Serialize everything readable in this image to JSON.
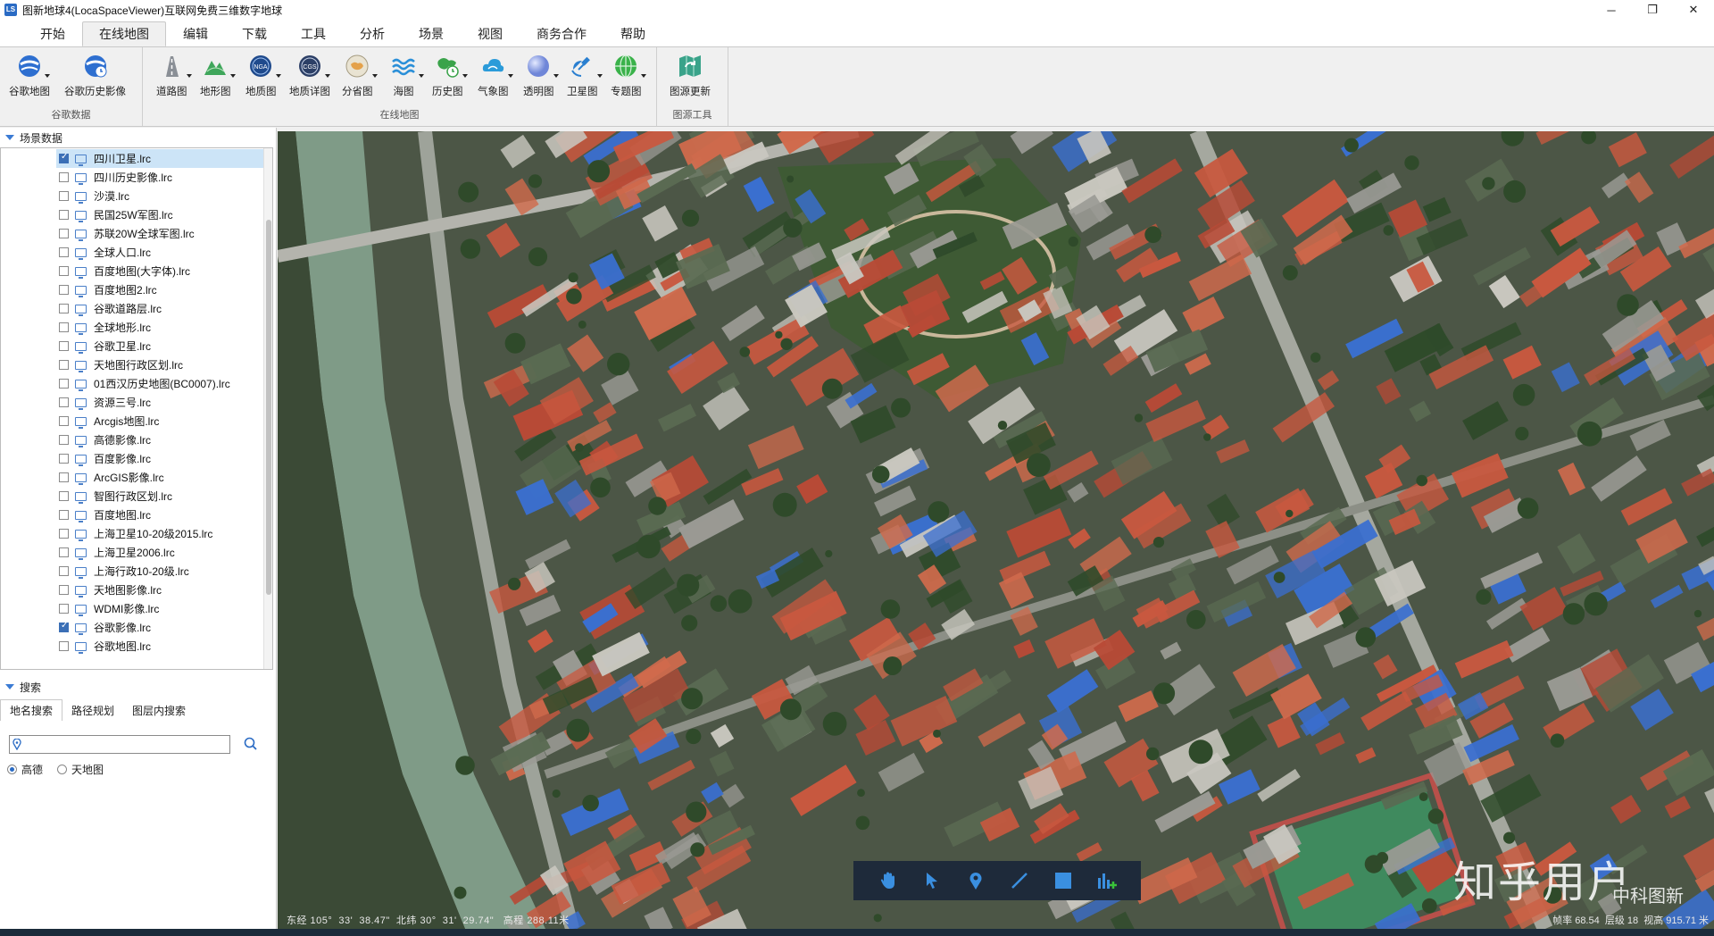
{
  "window": {
    "title": "图新地球4(LocaSpaceViewer)互联网免费三维数字地球",
    "logo_text": "LS",
    "minimize": "─",
    "maximize": "❐",
    "close": "✕"
  },
  "menu": [
    "开始",
    "在线地图",
    "编辑",
    "下载",
    "工具",
    "分析",
    "场景",
    "视图",
    "商务合作",
    "帮助"
  ],
  "menu_active": "在线地图",
  "ribbon": {
    "groups": [
      {
        "label": "谷歌数据",
        "tools": [
          {
            "label": "谷歌地图",
            "icon": "google-globe-icon"
          },
          {
            "label": "谷歌历史影像",
            "icon": "google-history-icon"
          }
        ]
      },
      {
        "label": "在线地图",
        "tools": [
          {
            "label": "道路图",
            "icon": "road-icon"
          },
          {
            "label": "地形图",
            "icon": "terrain-icon"
          },
          {
            "label": "地质图",
            "icon": "nga-icon"
          },
          {
            "label": "地质详图",
            "icon": "cgs-icon"
          },
          {
            "label": "分省图",
            "icon": "province-icon"
          },
          {
            "label": "海图",
            "icon": "sea-icon"
          },
          {
            "label": "历史图",
            "icon": "history-icon"
          },
          {
            "label": "气象图",
            "icon": "weather-icon"
          },
          {
            "label": "透明图",
            "icon": "transparent-icon"
          },
          {
            "label": "卫星图",
            "icon": "satellite-icon"
          },
          {
            "label": "专题图",
            "icon": "thematic-icon"
          }
        ]
      },
      {
        "label": "图源工具",
        "tools": [
          {
            "label": "图源更新",
            "icon": "source-update-icon"
          }
        ]
      }
    ]
  },
  "scene_panel": {
    "title": "场景数据",
    "items": [
      {
        "label": "四川卫星.lrc",
        "checked": true,
        "selected": true
      },
      {
        "label": "四川历史影像.lrc",
        "checked": false
      },
      {
        "label": "沙漠.lrc",
        "checked": false
      },
      {
        "label": "民国25W军图.lrc",
        "checked": false
      },
      {
        "label": "苏联20W全球军图.lrc",
        "checked": false
      },
      {
        "label": "全球人口.lrc",
        "checked": false
      },
      {
        "label": "百度地图(大字体).lrc",
        "checked": false
      },
      {
        "label": "百度地图2.lrc",
        "checked": false
      },
      {
        "label": "谷歌道路层.lrc",
        "checked": false
      },
      {
        "label": "全球地形.lrc",
        "checked": false
      },
      {
        "label": "谷歌卫星.lrc",
        "checked": false
      },
      {
        "label": "天地图行政区划.lrc",
        "checked": false
      },
      {
        "label": "01西汉历史地图(BC0007).lrc",
        "checked": false
      },
      {
        "label": "资源三号.lrc",
        "checked": false
      },
      {
        "label": "Arcgis地图.lrc",
        "checked": false
      },
      {
        "label": "高德影像.lrc",
        "checked": false
      },
      {
        "label": "百度影像.lrc",
        "checked": false
      },
      {
        "label": "ArcGIS影像.lrc",
        "checked": false
      },
      {
        "label": "智图行政区划.lrc",
        "checked": false
      },
      {
        "label": "百度地图.lrc",
        "checked": false
      },
      {
        "label": "上海卫星10-20级2015.lrc",
        "checked": false
      },
      {
        "label": "上海卫星2006.lrc",
        "checked": false
      },
      {
        "label": "上海行政10-20级.lrc",
        "checked": false
      },
      {
        "label": "天地图影像.lrc",
        "checked": false
      },
      {
        "label": "WDMI影像.lrc",
        "checked": false
      },
      {
        "label": "谷歌影像.lrc",
        "checked": true
      },
      {
        "label": "谷歌地图.lrc",
        "checked": false
      }
    ]
  },
  "search_panel": {
    "title": "搜索",
    "tabs": [
      "地名搜索",
      "路径规划",
      "图层内搜索"
    ],
    "active_tab": "地名搜索",
    "input_value": "",
    "options": [
      {
        "label": "高德",
        "selected": true
      },
      {
        "label": "天地图",
        "selected": false
      }
    ]
  },
  "map": {
    "status_left": "东经 105°  33'  38.47\"  北纬 30°  31'  29.74\"   高程 288.11米",
    "status_right": "帧率 68.54  层级 18  视高 915.71 米",
    "watermark": "知乎用户",
    "watermark_sub": "中科图新",
    "toolbar": [
      "hand-icon",
      "pointer-icon",
      "pin-icon",
      "line-icon",
      "rectangle-icon",
      "chart-add-icon"
    ],
    "colors": {
      "toolbar_bg": "#1e2a3a",
      "roof_red": "#c8583f",
      "roof_blue": "#3a6fd0",
      "river": "#7f9b87",
      "vegetation": "#2f4a2a"
    }
  }
}
